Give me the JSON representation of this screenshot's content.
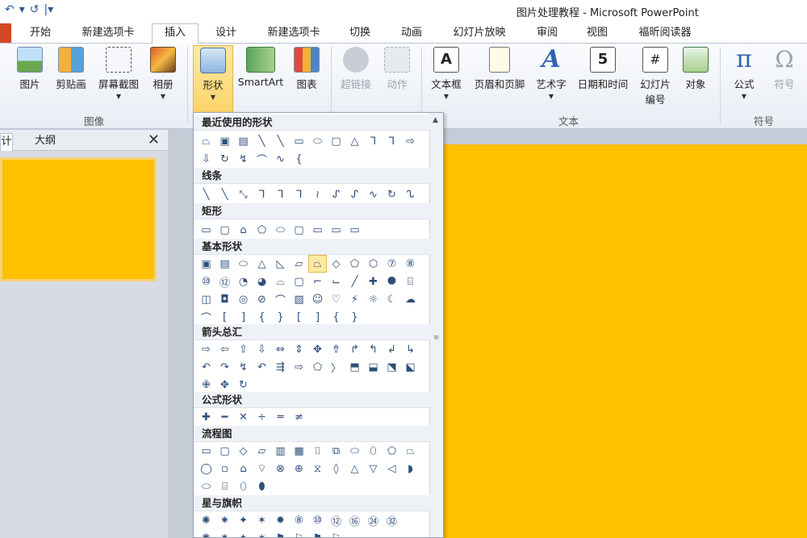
{
  "window": {
    "title": "图片处理教程 - Microsoft PowerPoint",
    "quick_access": [
      "↶",
      "▾",
      "↺",
      "|▾"
    ]
  },
  "tabs": [
    {
      "label": "开始"
    },
    {
      "label": "新建选项卡"
    },
    {
      "label": "插入"
    },
    {
      "label": "设计"
    },
    {
      "label": "新建选项卡"
    },
    {
      "label": "切换"
    },
    {
      "label": "动画"
    },
    {
      "label": "幻灯片放映"
    },
    {
      "label": "审阅"
    },
    {
      "label": "视图"
    },
    {
      "label": "福昕阅读器"
    }
  ],
  "ribbon": {
    "buttons": {
      "picture": "图片",
      "clipart": "剪贴画",
      "screenshot": "屏幕截图",
      "album": "相册",
      "shapes": "形状",
      "smartart": "SmartArt",
      "chart": "图表",
      "hyperlink": "超链接",
      "action": "动作",
      "textbox": "文本框",
      "header_footer": "页眉和页脚",
      "wordart": "艺术字",
      "datetime": "日期和时间",
      "slide_number_1": "幻灯片",
      "slide_number_2": "编号",
      "object": "对象",
      "equation": "公式",
      "symbol": "符号"
    },
    "groups": {
      "images": "图像",
      "text": "文本",
      "symbols": "符号"
    },
    "icon_glyphs": {
      "datetime": "5",
      "slide_number": "#",
      "equation": "π",
      "symbol": "Ω",
      "wordart": "A"
    }
  },
  "left_pane": {
    "tab_partial": "计",
    "tab_outline": "大纲",
    "close": "✕"
  },
  "dropdown": {
    "sections": [
      {
        "title": "最近使用的形状",
        "rows": [
          [
            "⏢",
            "▣",
            "▤",
            "╲",
            "╲",
            "▭",
            "⬭",
            "▢",
            "△",
            "⅂",
            "⅂",
            "⇨"
          ],
          [
            "⇩",
            "↻",
            "↯",
            "⌒",
            "∿",
            "{"
          ]
        ]
      },
      {
        "title": "线条",
        "rows": [
          [
            "╲",
            "╲",
            "⤡",
            "ᒣ",
            "ᒣ",
            "ᒣ",
            "≀",
            "ᔑ",
            "ᔑ",
            "∿",
            "↻",
            "ᔐ"
          ]
        ]
      },
      {
        "title": "矩形",
        "rows": [
          [
            "▭",
            "▢",
            "⌂",
            "⬠",
            "⬭",
            "▢",
            "▭",
            "▭",
            "▭"
          ]
        ]
      },
      {
        "title": "基本形状",
        "rows": [
          [
            "▣",
            "▤",
            "⬭",
            "△",
            "◺",
            "▱",
            "⏢",
            "◇",
            "⬠",
            "⬡",
            "⑦",
            "⑧"
          ],
          [
            "⑩",
            "⑫",
            "◔",
            "◕",
            "⌓",
            "▢",
            "⌐",
            "⌙",
            "╱",
            "✚",
            "⯃",
            "⌸"
          ],
          [
            "◫",
            "◘",
            "◎",
            "⊘",
            "⌒",
            "▨",
            "☺",
            "♡",
            "⚡",
            "☼",
            "☾",
            "☁"
          ],
          [
            "⌒",
            "[",
            "]",
            "{",
            "}",
            "[",
            "]",
            "{",
            "}"
          ]
        ]
      },
      {
        "title": "箭头总汇",
        "rows": [
          [
            "⇨",
            "⇦",
            "⇧",
            "⇩",
            "⇔",
            "⇕",
            "✥",
            "⇮",
            "↱",
            "↰",
            "↲",
            "↳"
          ],
          [
            "↶",
            "↷",
            "↯",
            "↶",
            "⇶",
            "⇨",
            "⬠",
            "〉",
            "⬒",
            "⬓",
            "⬔",
            "⬕"
          ],
          [
            "✙",
            "✥",
            "↻"
          ]
        ]
      },
      {
        "title": "公式形状",
        "rows": [
          [
            "✚",
            "━",
            "✕",
            "÷",
            "═",
            "≠"
          ]
        ]
      },
      {
        "title": "流程图",
        "rows": [
          [
            "▭",
            "▢",
            "◇",
            "▱",
            "▥",
            "▦",
            "⌷",
            "⧉",
            "⬭",
            "⬯",
            "⬠",
            "⏢"
          ],
          [
            "◯",
            "▫",
            "⌂",
            "⌔",
            "⊗",
            "⊕",
            "⧖",
            "◊",
            "△",
            "▽",
            "◁",
            "◗"
          ],
          [
            "⬭",
            "⌸",
            "⬯",
            "⬮"
          ]
        ]
      },
      {
        "title": "星与旗帜",
        "rows": [
          [
            "✺",
            "✷",
            "✦",
            "✶",
            "✹",
            "⑧",
            "⑩",
            "⑫",
            "⑯",
            "㉔",
            "㉜"
          ],
          [
            "✺",
            "✷",
            "✦",
            "✶",
            "⚑",
            "⚐",
            "⚑",
            "⚐"
          ]
        ]
      }
    ]
  }
}
